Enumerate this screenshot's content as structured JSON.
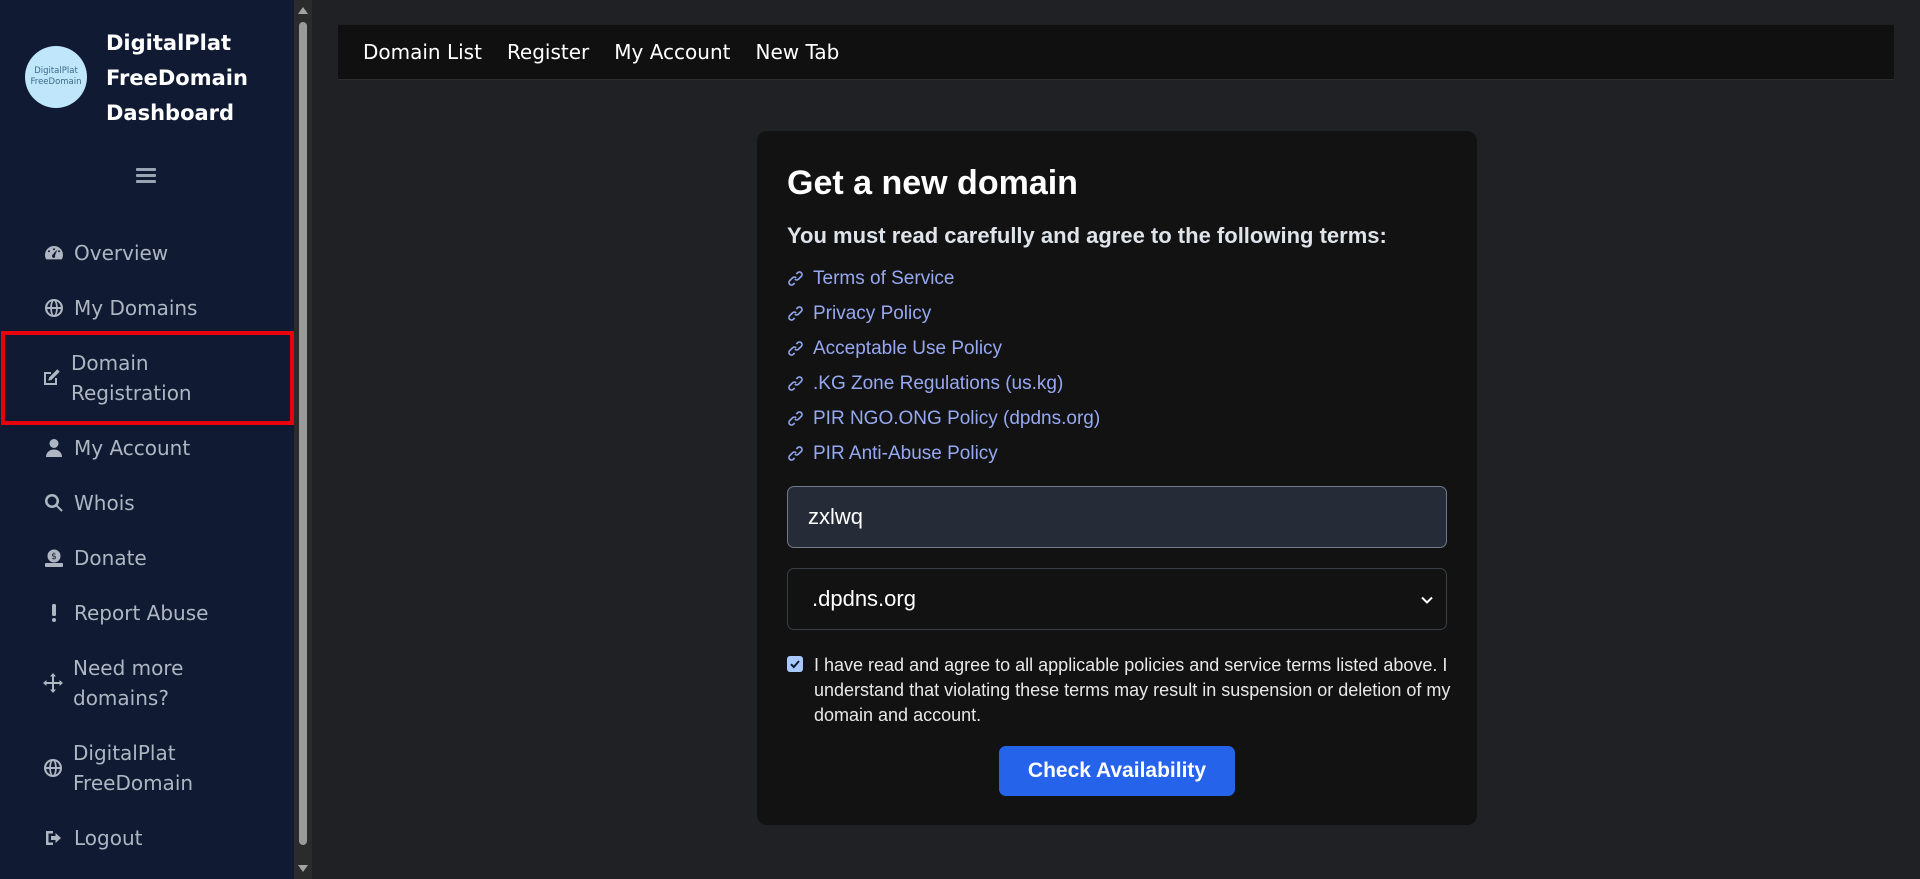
{
  "sidebar": {
    "logo_text_1": "DigitalPlat",
    "logo_text_2": "FreeDomain",
    "brand_line_1": "DigitalPlat",
    "brand_line_2": "FreeDomain",
    "brand_line_3": "Dashboard",
    "menu_icon": "hamburger-icon",
    "items": [
      {
        "label": "Overview",
        "icon": "gauge-icon"
      },
      {
        "label": "My Domains",
        "icon": "globe-icon"
      },
      {
        "label_1": "Domain",
        "label_2": "Registration",
        "icon": "edit-icon"
      },
      {
        "label": "My Account",
        "icon": "user-icon"
      },
      {
        "label": "Whois",
        "icon": "search-icon"
      },
      {
        "label": "Donate",
        "icon": "donate-icon"
      },
      {
        "label": "Report Abuse",
        "icon": "exclamation-icon"
      },
      {
        "label_1": "Need more",
        "label_2": "domains?",
        "icon": "arrows-icon"
      },
      {
        "label_1": "DigitalPlat",
        "label_2": "FreeDomain",
        "icon": "globe-icon"
      },
      {
        "label": "Logout",
        "icon": "logout-icon"
      }
    ],
    "highlight_color": "#e8000c"
  },
  "topnav": {
    "links": [
      "Domain List",
      "Register",
      "My Account",
      "New Tab"
    ]
  },
  "card": {
    "title": "Get a new domain",
    "terms_heading": "You must read carefully and agree to the following terms:",
    "links": [
      "Terms of Service",
      "Privacy Policy",
      "Acceptable Use Policy",
      ".KG Zone Regulations (us.kg)",
      "PIR NGO.ONG Policy (dpdns.org)",
      "PIR Anti-Abuse Policy"
    ],
    "domain_input_value": "zxlwq",
    "tld_selected": ".dpdns.org",
    "agree_checked": true,
    "agree_text": "I have read and agree to all applicable policies and service terms listed above. I understand that violating these terms may result in suspension or deletion of my domain and account.",
    "button_label": "Check Availability"
  },
  "colors": {
    "sidebar_bg": "#101b33",
    "accent": "#2563eb",
    "link": "#97a8f2"
  }
}
